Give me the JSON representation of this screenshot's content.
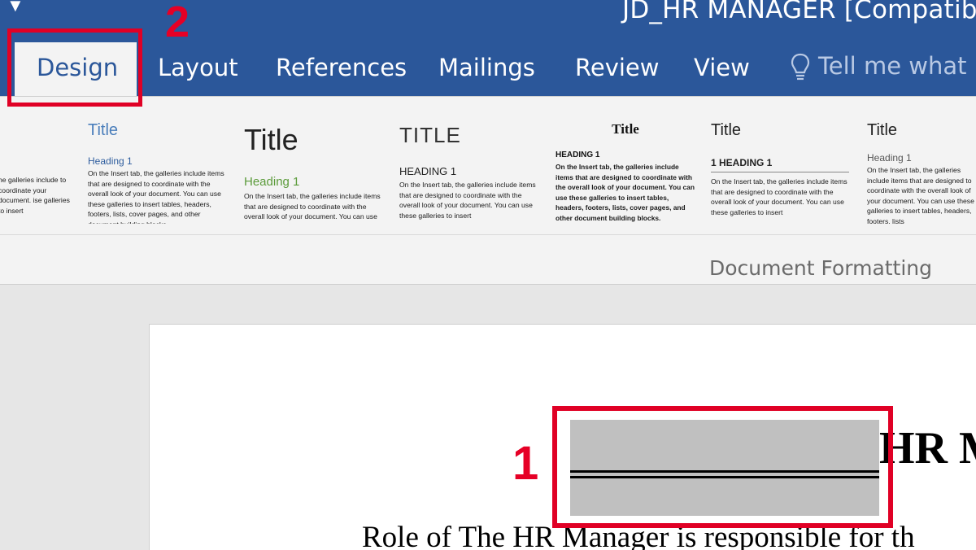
{
  "window": {
    "document_title": "JD_HR MANAGER [Compatibili"
  },
  "qat": {
    "icon": "customize-quick-access-arrow-icon"
  },
  "tabs": [
    "Design",
    "Layout",
    "References",
    "Mailings",
    "Review",
    "View"
  ],
  "tell_me": {
    "icon": "lightbulb-icon",
    "label": "Tell me what"
  },
  "style_gallery": [
    {
      "title": "",
      "heading": "",
      "body": "he galleries include to coordinate your document. ise galleries to insert"
    },
    {
      "title": "Title",
      "heading": "Heading 1",
      "body": "On the Insert tab, the galleries include items that are designed to coordinate with the overall look of your document. You can use these galleries to insert tables, headers, footers, lists, cover pages, and other document building blocks."
    },
    {
      "title": "Title",
      "heading": "Heading 1",
      "body": "On the Insert tab, the galleries include items that are designed to coordinate with the overall look of your document. You can use"
    },
    {
      "title": "TITLE",
      "heading": "HEADING 1",
      "body": "On the Insert tab, the galleries include items that are designed to coordinate with the overall look of your document. You can use these galleries to insert"
    },
    {
      "title": "Title",
      "heading": "HEADING 1",
      "body": "On the Insert tab, the galleries include items that are designed to coordinate with the overall look of your document. You can use these galleries to insert tables, headers, footers, lists, cover pages, and other document building blocks."
    },
    {
      "title": "Title",
      "heading": "1   HEADING 1",
      "body": "On the Insert tab, the galleries include items that are designed to coordinate with the overall look of your document. You can use these galleries to insert"
    },
    {
      "title": "Title",
      "heading": "Heading 1",
      "body": "On the Insert tab, the galleries include items that are designed to coordinate with the overall look of your document. You can use these galleries to insert tables, headers, footers, lists"
    }
  ],
  "group_label": "Document Formatting",
  "document": {
    "heading_partial": "HR M",
    "body_partial": "Role of The HR Manager is responsible for th"
  },
  "annotations": {
    "step1": "1",
    "step2": "2"
  },
  "colors": {
    "ribbon_blue": "#2b579a",
    "annotation_red": "#e00025"
  }
}
